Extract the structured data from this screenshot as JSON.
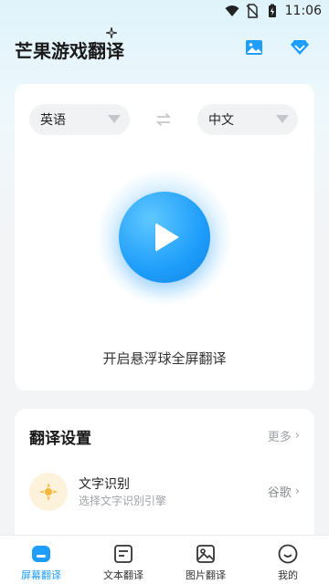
{
  "status_bar": {
    "time": "11:06",
    "icons": [
      "wifi-icon",
      "no-sim-icon",
      "battery-charging-icon"
    ]
  },
  "header": {
    "title": "芒果游戏翻译",
    "actions": [
      "image-icon",
      "diamond-vip-icon"
    ]
  },
  "translator": {
    "source_language": "英语",
    "target_language": "中文",
    "start_label": "开启悬浮球全屏翻译"
  },
  "settings": {
    "title": "翻译设置",
    "more_label": "更多",
    "ocr": {
      "title": "文字识别",
      "subtitle": "选择文字识别引擎",
      "value": "谷歌"
    }
  },
  "bottom_nav": {
    "items": [
      {
        "label": "屏幕翻译",
        "icon": "screen-translate-icon",
        "active": true
      },
      {
        "label": "文本翻译",
        "icon": "text-translate-icon",
        "active": false
      },
      {
        "label": "图片翻译",
        "icon": "image-translate-icon",
        "active": false
      },
      {
        "label": "我的",
        "icon": "profile-icon",
        "active": false
      }
    ]
  },
  "colors": {
    "accent": "#1e9dfa",
    "ocr_icon": "#f5b93a"
  }
}
